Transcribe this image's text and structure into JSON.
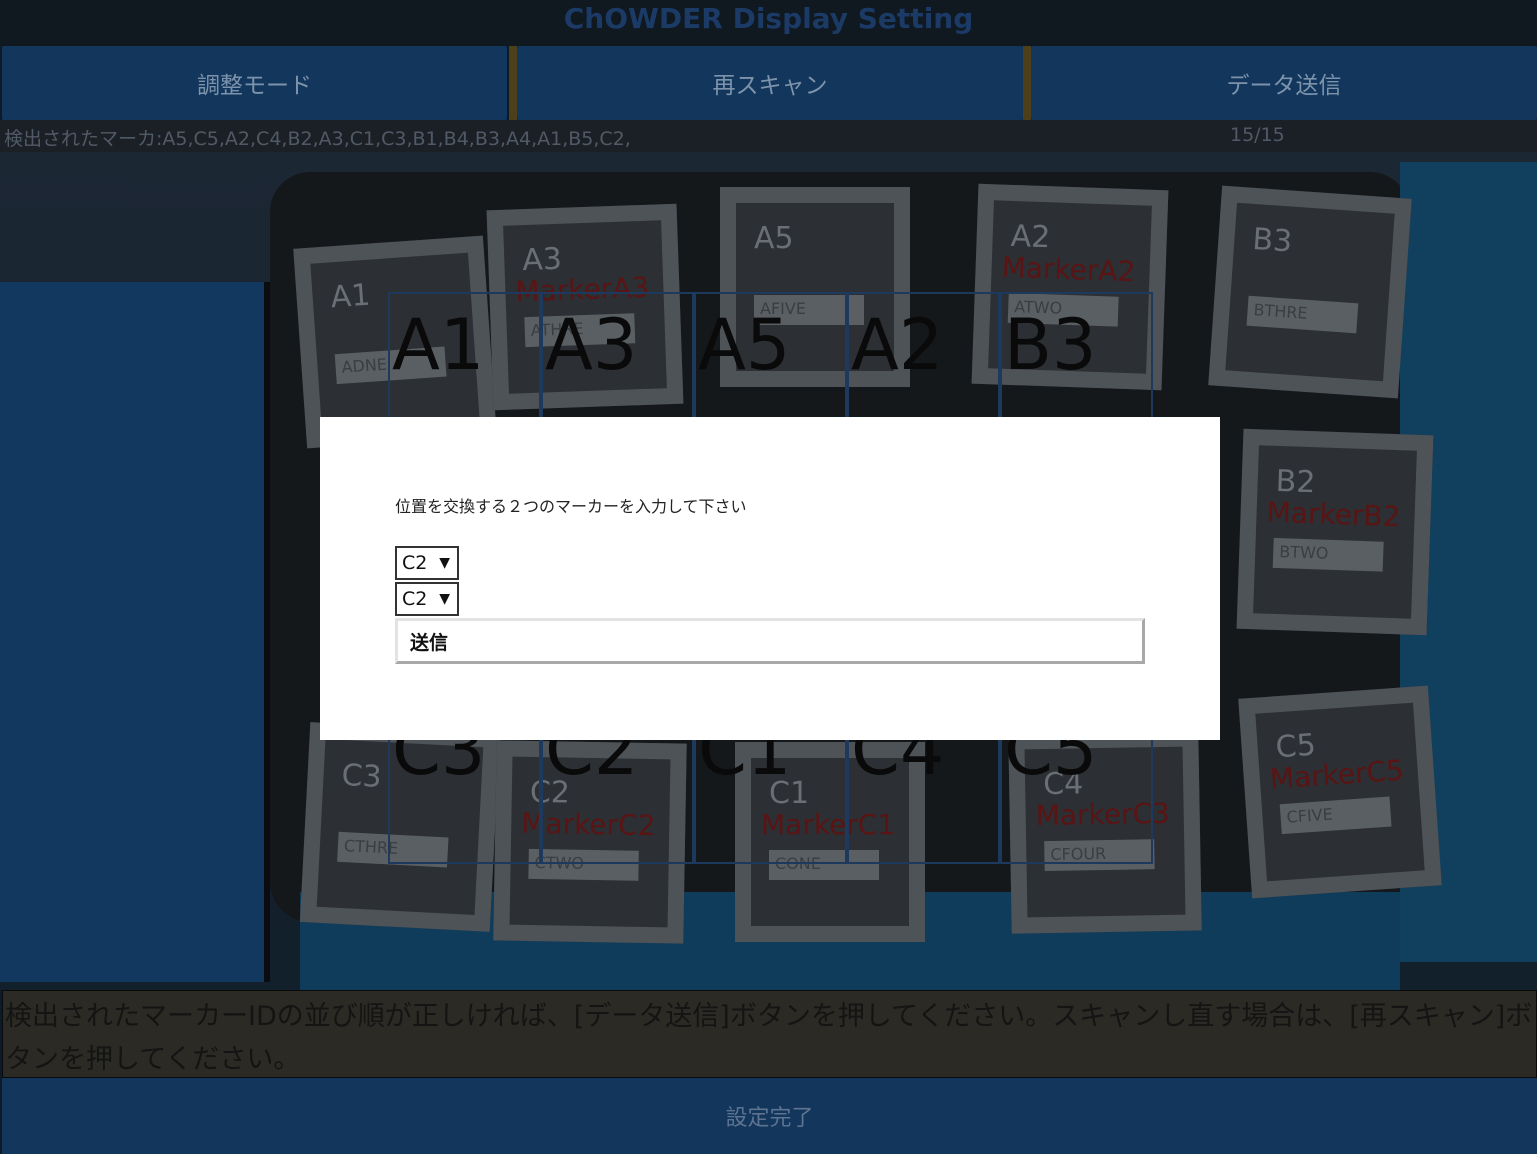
{
  "app": {
    "title": "ChOWDER Display Setting"
  },
  "tabs": [
    {
      "label": "調整モード"
    },
    {
      "label": "再スキャン"
    },
    {
      "label": "データ送信"
    }
  ],
  "detected": {
    "label": "検出されたマーカ:A5,C5,A2,C4,B2,A3,C1,C3,B1,B4,B3,A4,A1,B5,C2,",
    "count": "15/15"
  },
  "camera": {
    "grid_top_labels": [
      "A1",
      "A3",
      "A5",
      "A2",
      "B3"
    ],
    "grid_bottom_labels": [
      "C3",
      "C2",
      "C1",
      "C4",
      "C5"
    ],
    "tiles": [
      {
        "code": "A1",
        "tag": "ADNE",
        "marker": ""
      },
      {
        "code": "A3",
        "tag": "ATHRE",
        "marker": "MarkerA3"
      },
      {
        "code": "A5",
        "tag": "AFIVE",
        "marker": ""
      },
      {
        "code": "A2",
        "tag": "ATWO",
        "marker": "MarkerA2"
      },
      {
        "code": "B3",
        "tag": "BTHRE",
        "marker": ""
      },
      {
        "code": "B2",
        "tag": "BTWO",
        "marker": "MarkerB2"
      },
      {
        "code": "C3",
        "tag": "CTHRE",
        "marker": ""
      },
      {
        "code": "C2",
        "tag": "CTWO",
        "marker": "MarkerC2"
      },
      {
        "code": "C1",
        "tag": "CONE",
        "marker": "MarkerC1"
      },
      {
        "code": "C4",
        "tag": "CFOUR",
        "marker": "MarkerC3"
      },
      {
        "code": "C5",
        "tag": "CFIVE",
        "marker": "MarkerC5"
      }
    ]
  },
  "instruction": "検出されたマーカーIDの並び順が正しければ、[データ送信]ボタンを押してください。スキャンし直す場合は、[再スキャン]ボタンを押してください。",
  "footer": {
    "label": "設定完了"
  },
  "modal": {
    "prompt": "位置を交換する２つのマーカーを入力して下さい",
    "select_first": "C2",
    "select_second": "C2",
    "send_label": "送信"
  }
}
